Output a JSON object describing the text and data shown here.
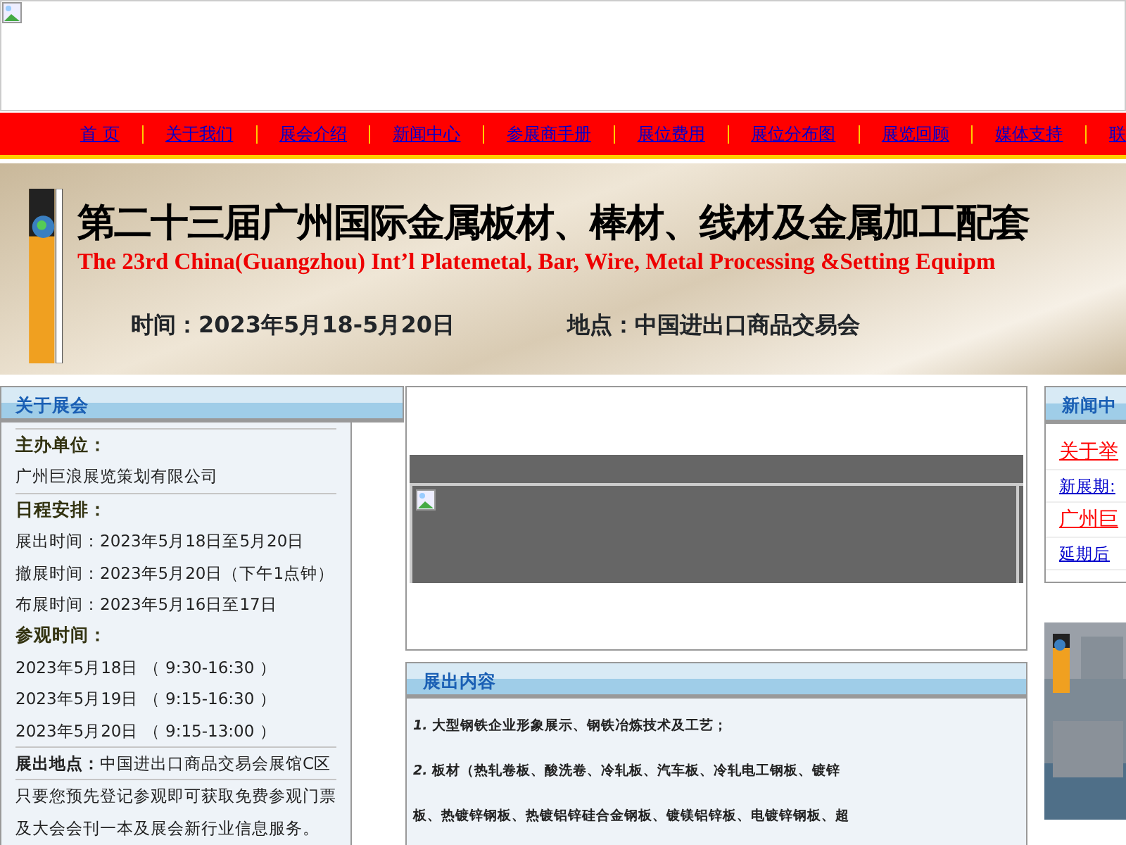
{
  "nav": [
    {
      "label": "首 页"
    },
    {
      "label": "关于我们"
    },
    {
      "label": "展会介绍"
    },
    {
      "label": "新闻中心"
    },
    {
      "label": "参展商手册"
    },
    {
      "label": "展位费用"
    },
    {
      "label": "展位分布图"
    },
    {
      "label": "展览回顾"
    },
    {
      "label": "媒体支持"
    },
    {
      "label": "联"
    }
  ],
  "banner": {
    "title": "第二十三届广州国际金属板材、棒材、线材及金属加工配套",
    "subtitle": "The 23rd China(Guangzhou) Int’l Platemetal, Bar, Wire, Metal Processing &Setting Equipm",
    "date": "时间：2023年5月18-5月20日",
    "place": "地点：中国进出口商品交易会"
  },
  "about": {
    "title": "关于展会",
    "items": [
      {
        "kind": "heading",
        "text": "**主办单位：**",
        "divider": true
      },
      {
        "kind": "line",
        "text": "广州巨浪展览策划有限公司"
      },
      {
        "kind": "heading",
        "text": "**日程安排：**",
        "divider": true
      },
      {
        "kind": "line",
        "text": "展出时间：2023年5月18日至5月20日"
      },
      {
        "kind": "line",
        "text": "撤展时间：2023年5月20日（下午1点钟）"
      },
      {
        "kind": "line",
        "text": "布展时间：2023年5月16日至17日"
      },
      {
        "kind": "heading",
        "text": "**参观时间：**"
      },
      {
        "kind": "line",
        "text": "2023年5月18日 （ 9:30-16:30 ）"
      },
      {
        "kind": "line",
        "text": "2023年5月19日 （ 9:15-16:30 ）"
      },
      {
        "kind": "line",
        "text": "2023年5月20日 （ 9:15-13:00 ）"
      },
      {
        "kind": "line",
        "text": "**展出地点：**中国进出口商品交易会展馆C区",
        "divider": true
      },
      {
        "kind": "line",
        "text": "只要您预先登记参观即可获取免费参观门票",
        "divider": true
      },
      {
        "kind": "line",
        "text": "及大会会刊一本及展会新行业信息服务。"
      }
    ]
  },
  "exhibits": {
    "title": "展出内容",
    "lines": [
      "*1.* 大型钢铁企业形象展示、钢铁冶炼技术及工艺；",
      "*2.* 板材（热轧卷板、酸洗卷、冷轧板、汽车板、冷轧电工钢板、镀锌",
      "板、热镀锌钢板、热镀铝锌硅合金钢板、镀镁铝锌板、电镀锌钢板、超"
    ]
  },
  "news": {
    "title": "新闻中",
    "items": [
      {
        "text": "关于举",
        "highlight": true
      },
      {
        "text": "新展期:",
        "highlight": false
      },
      {
        "text": "广州巨",
        "highlight": true
      },
      {
        "text": "延期后",
        "highlight": false
      }
    ]
  }
}
